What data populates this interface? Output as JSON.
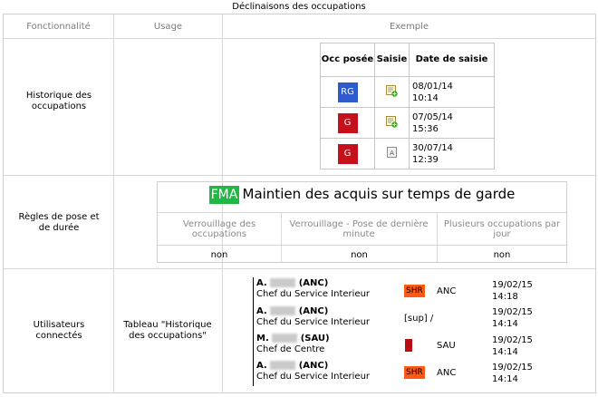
{
  "caption": "Déclinaisons des occupations",
  "headers": {
    "feature": "Fonctionnalité",
    "usage": "Usage",
    "example": "Exemple"
  },
  "rows": {
    "history": {
      "feature": "Historique des occupations",
      "usage": ""
    },
    "rules": {
      "feature": "Règles de pose et de durée",
      "usage": ""
    },
    "users": {
      "feature": "Utilisateurs connectés",
      "usage": "Tableau \"Historique des occupations\""
    }
  },
  "occ_table": {
    "col_occ": "Occ posée",
    "col_saisie": "Saisie",
    "col_date": "Date de saisie",
    "rows": [
      {
        "badge": "RG",
        "badge_color": "#2e5acb",
        "icon": "add-entry-icon",
        "date": "08/01/14",
        "time": "10:14"
      },
      {
        "badge": "G",
        "badge_color": "#c4111b",
        "icon": "add-entry-icon",
        "date": "07/05/14",
        "time": "15:36"
      },
      {
        "badge": "G",
        "badge_color": "#c4111b",
        "icon": "auto-entry-icon",
        "date": "30/07/14",
        "time": "12:39"
      }
    ]
  },
  "rules_box": {
    "badge": "FMA",
    "badge_color": "#1fb845",
    "title": "Maintien des acquis sur temps de garde",
    "columns": [
      "Verrouillage des occupations",
      "Verrouillage - Pose de dernière minute",
      "Plusieurs occupations par jour"
    ],
    "values": [
      "non",
      "non",
      "non"
    ]
  },
  "users_list": [
    {
      "initial": "A.",
      "suffix": "(ANC)",
      "role": "Chef du Service Interieur",
      "status": "SHR",
      "status_color": "#ff5a14",
      "code": "ANC",
      "date": "19/02/15",
      "time": "14:18"
    },
    {
      "initial": "A.",
      "suffix": "(ANC)",
      "role": "Chef du Service Interieur",
      "status": "[sup] /",
      "status_color": "",
      "code": "",
      "date": "19/02/15",
      "time": "14:14"
    },
    {
      "initial": "M.",
      "suffix": "(SAU)",
      "role": "Chef de Centre",
      "status": "G",
      "status_color": "#b80d14",
      "code": "SAU",
      "date": "19/02/15",
      "time": "14:14"
    },
    {
      "initial": "A.",
      "suffix": "(ANC)",
      "role": "Chef du Service Interieur",
      "status": "SHR",
      "status_color": "#ff5a14",
      "code": "ANC",
      "date": "19/02/15",
      "time": "14:14"
    }
  ]
}
